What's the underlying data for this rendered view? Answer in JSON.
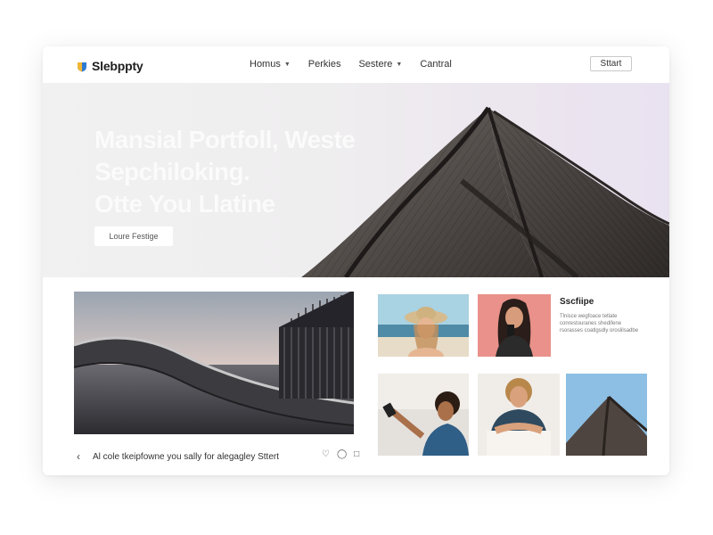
{
  "brand": {
    "name": "Slebppty"
  },
  "nav": [
    {
      "label": "Homus",
      "has_dropdown": true
    },
    {
      "label": "Perkies",
      "has_dropdown": false
    },
    {
      "label": "Sestere",
      "has_dropdown": true
    },
    {
      "label": "Cantral",
      "has_dropdown": false
    }
  ],
  "header": {
    "cta_label": "Sttart"
  },
  "hero": {
    "lines": [
      "Mansial Portfoll, Weste",
      "Sepchiloking.",
      "Otte You Llatine"
    ],
    "button_label": "Loure Festige"
  },
  "feature": {
    "caption": "Al cole tkeipfowne you sally for alegagley Sttert"
  },
  "side": {
    "title": "Sscfiipe",
    "description": "Tlnisce wegfoace tetlate conrestouranes shedifene rsorasses coatlgsdly oroslilsadbe"
  },
  "colors": {
    "hero_text": "#fbfbfb",
    "roof_dark": "#3f3a36",
    "accent_pink": "#e9918a"
  },
  "icons": [
    "logo-shield-icon",
    "chevron-down-icon",
    "back-arrow-icon",
    "heart-icon",
    "comment-icon",
    "share-icon"
  ]
}
